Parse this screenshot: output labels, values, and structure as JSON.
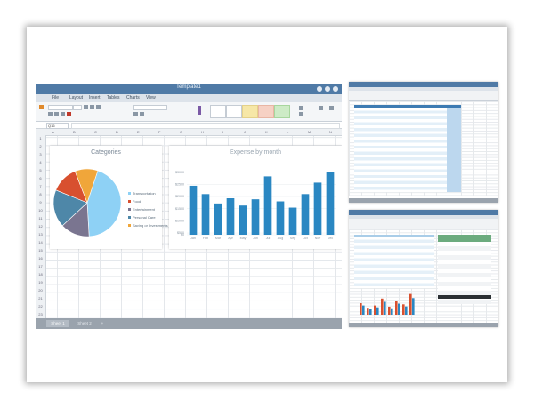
{
  "window": {
    "title": "Template1",
    "menus": [
      "File",
      "Layout",
      "Insert",
      "Tables",
      "Charts",
      "View"
    ],
    "name_box": "Q16"
  },
  "columns": [
    "A",
    "B",
    "C",
    "D",
    "E",
    "F",
    "G",
    "H",
    "I",
    "J",
    "K",
    "L",
    "M",
    "N"
  ],
  "rows": [
    "1",
    "2",
    "3",
    "4",
    "5",
    "6",
    "7",
    "8",
    "9",
    "10",
    "11",
    "12",
    "13",
    "14",
    "15",
    "16",
    "17",
    "18",
    "19",
    "20",
    "21",
    "22",
    "23"
  ],
  "sheets": [
    "Sheet 1",
    "Sheet 2",
    "+"
  ],
  "pie_chart": {
    "title": "Categories",
    "colors": [
      "#8ed1f5",
      "#7a7590",
      "#4e87a8",
      "#d8502f",
      "#f0a63a"
    ],
    "slices": [
      {
        "label": "Transportation",
        "value": 44,
        "color": "#8ed1f5"
      },
      {
        "label": "Food",
        "value": 14,
        "color": "#7a7590"
      },
      {
        "label": "Entertainment",
        "value": 18,
        "color": "#4e87a8"
      },
      {
        "label": "Personal Care",
        "value": 13,
        "color": "#d8502f"
      },
      {
        "label": "Saving or Investments",
        "value": 11,
        "color": "#f0a63a"
      }
    ]
  },
  "chart_data": {
    "type": "bar",
    "title": "Expense by month",
    "categories": [
      "Jan",
      "Feb",
      "Mar",
      "Apr",
      "May",
      "Jun",
      "Jul",
      "Aug",
      "Sep",
      "Oct",
      "Nov",
      "Dec"
    ],
    "values": [
      2350,
      1950,
      1500,
      1750,
      1400,
      1700,
      2800,
      1600,
      1300,
      1950,
      2500,
      3000
    ],
    "ylim": [
      0,
      3500
    ],
    "yticks": [
      "$3000",
      "$2500",
      "$2000",
      "$1500",
      "$1000",
      "$500",
      "$0"
    ],
    "color": "#2a87c2",
    "grid": true
  },
  "accent_color": "#4f7aa6"
}
